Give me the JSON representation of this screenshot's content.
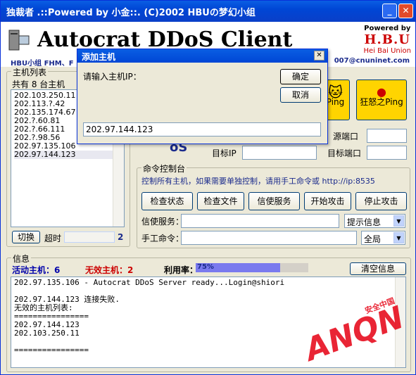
{
  "window": {
    "title": "独裁者 .::Powered by 小金::. (C)2002 HBUの梦幻小组",
    "min": "_",
    "close": "✕"
  },
  "header": {
    "app_title": "Autocrat DDoS Client",
    "subline": "HBU小组 FHM、F",
    "email": "007@cnuninet.com",
    "powered": "Powered by",
    "brand": "H.B.U",
    "brand_sub": "Hei Bai Union"
  },
  "hostlist": {
    "label": "主机列表",
    "count_text": "共有 8 台主机",
    "items": [
      "202.103.250.11",
      "202.113.?.42",
      "202.135.174.67",
      "202.?.60.81",
      "202.?.66.111",
      "202.?.98.56",
      "202.97.135.106",
      "202.97.144.123"
    ],
    "switch_label": "切换",
    "timeout_label": "超时",
    "page_num": "2"
  },
  "ping": {
    "small_label": "Ping",
    "big_label": "狂怒之Ping"
  },
  "target": {
    "src_port_label": "源端口",
    "target_ip_label": "目标IP",
    "target_port_label": "目标端口",
    "partial": "oS"
  },
  "command": {
    "group_label": "命令控制台",
    "hint": "控制所有主机，如果需要单独控制，请用手工命令或 http://ip:8535",
    "buttons": [
      "检查状态",
      "检查文件",
      "信使服务",
      "开始攻击",
      "停止攻击"
    ],
    "messenger_label": "信使服务：",
    "messenger_select": "提示信息",
    "manual_label": "手工命令：",
    "manual_select": "全局"
  },
  "info": {
    "group_label": "信息",
    "active_label": "活动主机：",
    "active_count": "6",
    "invalid_label": "无效主机：",
    "invalid_count": "2",
    "usage_label": "利用率：",
    "usage_value": "75%",
    "usage_fraction": 0.75,
    "clear_label": "清空信息",
    "log": "202.97.135.106 - Autocrat DDoS Server ready...Login@shiori\n\n202.97.144.123 连接失败.\n无效的主机列表:\n================\n202.97.144.123\n202.103.250.11\n\n================"
  },
  "dialog": {
    "title": "添加主机",
    "prompt": "请输入主机IP：",
    "ok": "确定",
    "cancel": "取消",
    "value": "202.97.144.123"
  },
  "watermark": {
    "text": "ANQN",
    "sub": "安全中国"
  }
}
